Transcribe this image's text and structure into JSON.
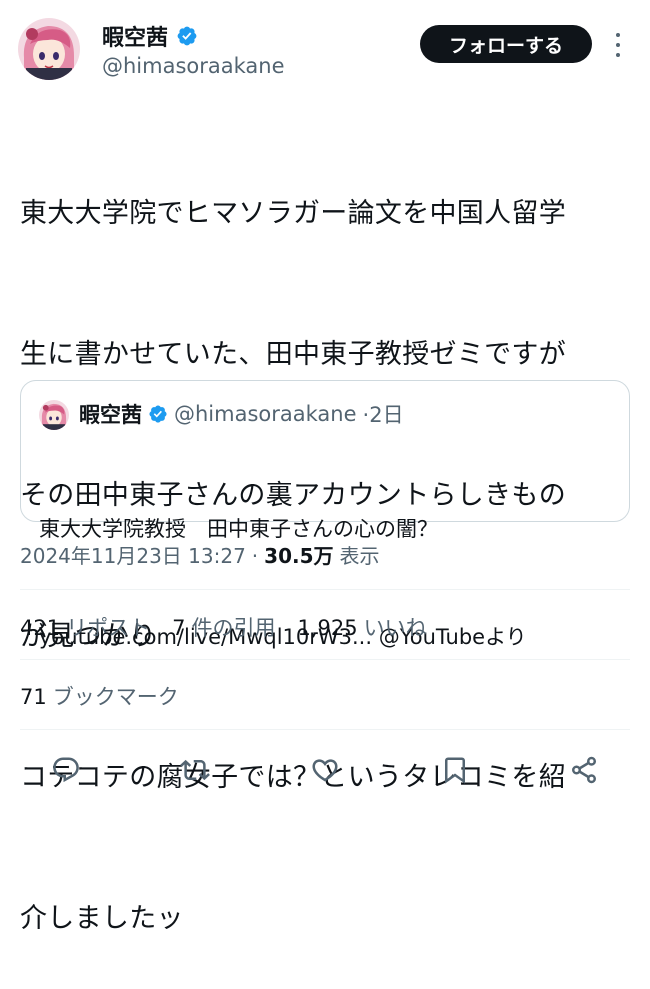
{
  "author": {
    "name": "暇空茜",
    "handle": "@himasoraakane",
    "verified": true,
    "follow_label": "フォローする"
  },
  "tweet": {
    "text_lines": [
      "東大大学院でヒマソラガー論文を中国人留学",
      "生に書かせていた、田中東子教授ゼミですが",
      "その田中東子さんの裏アカウントらしきもの",
      "が見つかり",
      "コテコテの腐女子では？というタレコミを紹",
      "介しましたッ"
    ]
  },
  "quote": {
    "name": "暇空茜",
    "handle": "@himasoraakane",
    "age": "·2日",
    "line1": "東大大学院教授　田中東子さんの心の闇？",
    "line2": "youtube.com/live/Mwql10rW3... @YouTubeより"
  },
  "meta": {
    "datetime": "2024年11月23日 13:27",
    "separator": "·",
    "views": "30.5万",
    "views_label": "表示"
  },
  "stats": {
    "reposts_count": "421",
    "reposts_label": "リポスト",
    "quotes_count": "7",
    "quotes_label": "件の引用",
    "likes_count": "1,925",
    "likes_label": "いいね",
    "bookmarks_count": "71",
    "bookmarks_label": "ブックマーク"
  },
  "colors": {
    "text": "#0f1419",
    "secondary": "#536471",
    "verified": "#1d9bf0",
    "border": "#cfd9de"
  },
  "icons": [
    "verified-badge-icon",
    "more-icon",
    "reply-icon",
    "repost-icon",
    "like-icon",
    "bookmark-icon",
    "share-icon"
  ]
}
